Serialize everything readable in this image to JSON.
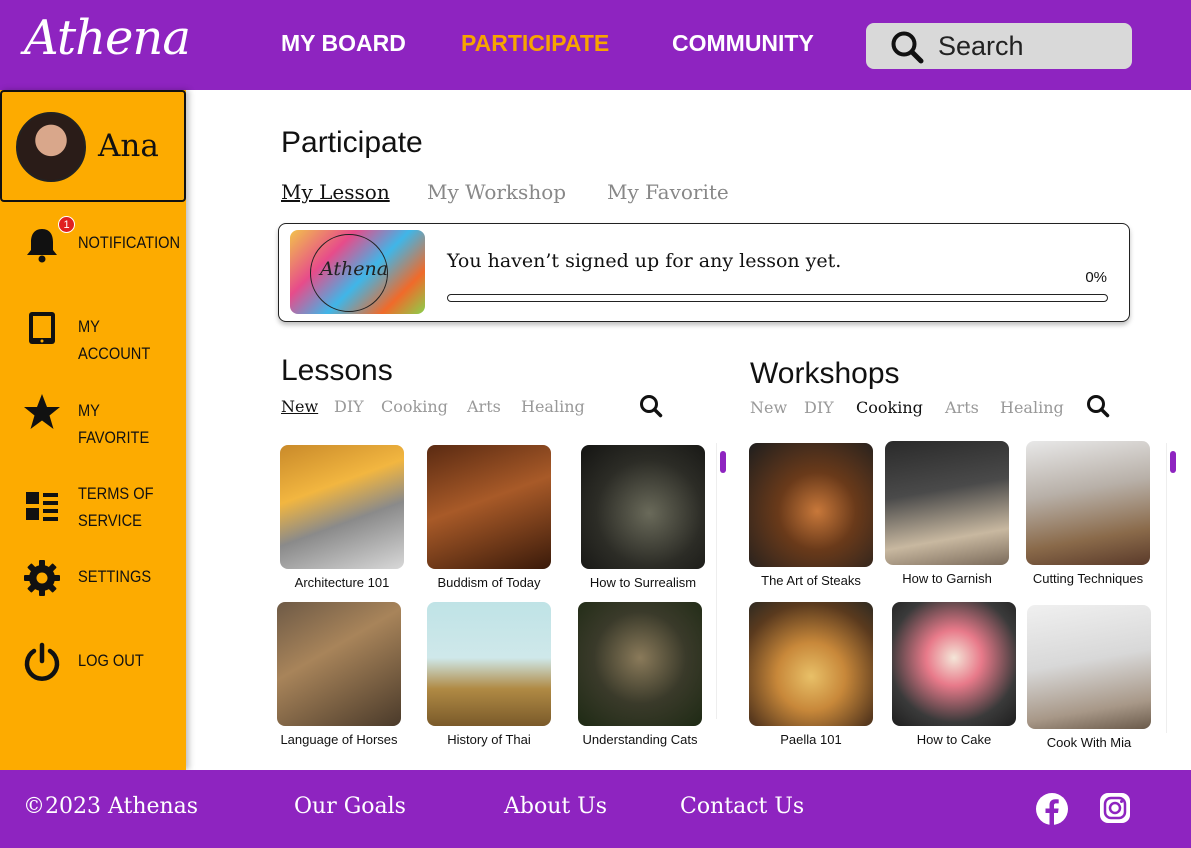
{
  "app": {
    "logo": "Athena"
  },
  "header": {
    "nav": [
      {
        "label": "MY BOARD"
      },
      {
        "label": "PARTICIPATE"
      },
      {
        "label": "COMMUNITY"
      }
    ],
    "search": {
      "placeholder": "Search"
    }
  },
  "sidebar": {
    "user": {
      "name": "Ana"
    },
    "notification_count": "1",
    "items": [
      {
        "label": "NOTIFICATION",
        "icon": "bell-icon"
      },
      {
        "label": "MY ACCOUNT",
        "icon": "tablet-icon"
      },
      {
        "label": "MY FAVORITE",
        "icon": "star-icon"
      },
      {
        "label": "TERMS OF SERVICE",
        "line1": "TERMS OF",
        "line2": "SERVICE",
        "icon": "list-icon"
      },
      {
        "label": "SETTINGS",
        "icon": "gear-icon"
      },
      {
        "label": "LOG OUT",
        "icon": "power-icon"
      }
    ]
  },
  "main": {
    "title": "Participate",
    "tabs": [
      {
        "label": "My Lesson"
      },
      {
        "label": "My Workshop"
      },
      {
        "label": "My Favorite"
      }
    ],
    "progress_card": {
      "thumb_text": "Athena",
      "message": "You haven’t signed up for any lesson yet.",
      "percent_label": "0%",
      "progress": 0
    },
    "lessons": {
      "title": "Lessons",
      "filters": [
        "New",
        "DIY",
        "Cooking",
        "Arts",
        "Healing"
      ],
      "items": [
        {
          "caption": "Architecture 101"
        },
        {
          "caption": "Buddism of Today"
        },
        {
          "caption": "How to Surrealism"
        },
        {
          "caption": "Language of Horses"
        },
        {
          "caption": "History of Thai"
        },
        {
          "caption": "Understanding Cats"
        }
      ]
    },
    "workshops": {
      "title": "Workshops",
      "filters": [
        "New",
        "DIY",
        "Cooking",
        "Arts",
        "Healing"
      ],
      "items": [
        {
          "caption": "The Art of Steaks"
        },
        {
          "caption": "How to Garnish"
        },
        {
          "caption": "Cutting Techniques"
        },
        {
          "caption": "Paella 101"
        },
        {
          "caption": "How to Cake"
        },
        {
          "caption": "Cook With Mia"
        }
      ]
    }
  },
  "footer": {
    "copyright": "©2023 Athenas",
    "links": [
      {
        "label": "Our Goals"
      },
      {
        "label": "About Us"
      },
      {
        "label": "Contact Us"
      }
    ],
    "social": [
      "facebook-icon",
      "instagram-icon"
    ]
  },
  "colors": {
    "brand_purple": "#8e24c0",
    "accent_orange": "#fdab00",
    "active_nav": "#f7a400"
  }
}
